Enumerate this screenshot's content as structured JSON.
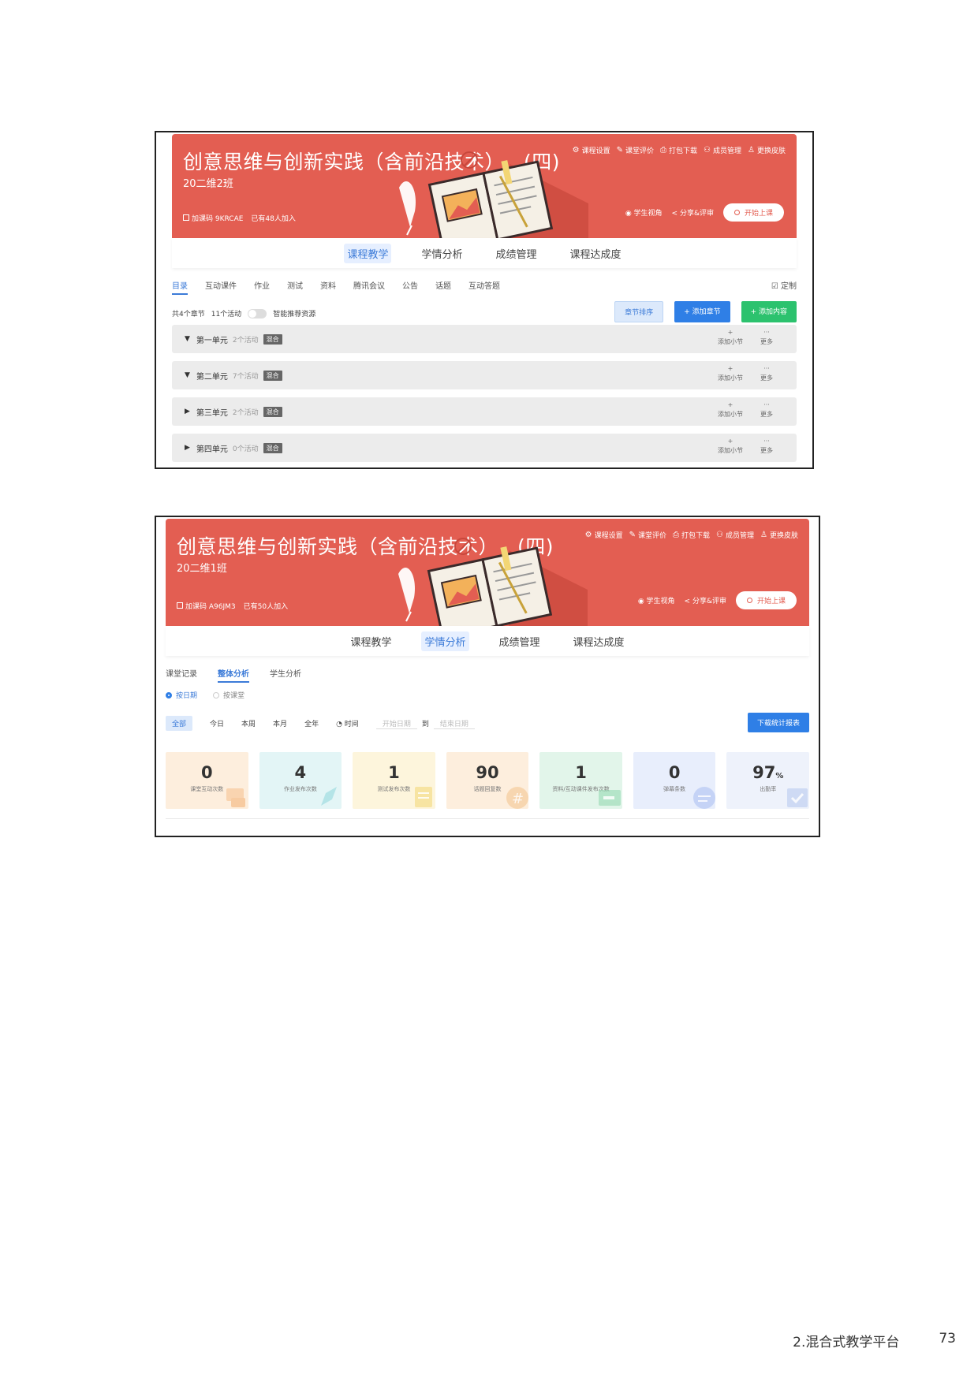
{
  "screenshot_top": {
    "course_title": "创意思维与创新实践（含前沿技术）",
    "course_suffix": "(四)",
    "class_name": "20二维2班",
    "join_code": "加课码 9KRCAE",
    "joined": "已有48人加入",
    "top_menu": [
      "课程设置",
      "课堂评价",
      "打包下载",
      "成员管理",
      "更换皮肤"
    ],
    "bottom_menu": [
      "学生视角",
      "分享&评审"
    ],
    "start_label": "开始上课",
    "main_tabs": [
      "课程教学",
      "学情分析",
      "成绩管理",
      "课程达成度"
    ],
    "sub_tabs": [
      "目录",
      "互动课件",
      "作业",
      "测试",
      "资料",
      "腾讯会议",
      "公告",
      "话题",
      "互动答题"
    ],
    "customize": "定制",
    "chapter_count": "共4个章节",
    "activity_count": "11个活动",
    "smart_recommend": "智能推荐资源",
    "buttons": {
      "order": "章节排序",
      "add_chapter": "+ 添加章节",
      "add_content": "+ 添加内容"
    },
    "units": [
      {
        "name": "第一单元",
        "count": "2个活动",
        "badge": "混合",
        "arrow": "▼"
      },
      {
        "name": "第二单元",
        "count": "7个活动",
        "badge": "混合",
        "arrow": "▼"
      },
      {
        "name": "第三单元",
        "count": "2个活动",
        "badge": "混合",
        "arrow": "▶"
      },
      {
        "name": "第四单元",
        "count": "0个活动",
        "badge": "混合",
        "arrow": "▶"
      }
    ],
    "unit_actions": [
      "添加小节",
      "更多"
    ]
  },
  "screenshot_bottom": {
    "course_title": "创意思维与创新实践（含前沿技术）",
    "course_suffix": "(四)",
    "class_name": "20二维1班",
    "join_code": "加课码 A96JM3",
    "joined": "已有50人加入",
    "top_menu": [
      "课程设置",
      "课堂评价",
      "打包下载",
      "成员管理",
      "更换皮肤"
    ],
    "bottom_menu": [
      "学生视角",
      "分享&评审"
    ],
    "start_label": "开始上课",
    "main_tabs": [
      "课程教学",
      "学情分析",
      "成绩管理",
      "课程达成度"
    ],
    "analysis_tabs": [
      "课堂记录",
      "整体分析",
      "学生分析"
    ],
    "radios": [
      "按日期",
      "按课堂"
    ],
    "filters": [
      "全部",
      "今日",
      "本周",
      "本月",
      "全年"
    ],
    "time_label": "时间",
    "start_date": "开始日期",
    "to": "到",
    "end_date": "结束日期",
    "download": "下载统计报表",
    "cards": [
      {
        "value": "0",
        "label": "课堂互动次数",
        "color": "#fdeedd",
        "accent": "#f6c08a"
      },
      {
        "value": "4",
        "label": "作业发布次数",
        "color": "#e3f5f6",
        "accent": "#8fd6db"
      },
      {
        "value": "1",
        "label": "测试发布次数",
        "color": "#fdf5dc",
        "accent": "#f3d674"
      },
      {
        "value": "90",
        "label": "话题回复数",
        "color": "#fdeedd",
        "accent": "#f3c48a"
      },
      {
        "value": "1",
        "label": "资料/互动课件发布次数",
        "color": "#e2f5ea",
        "accent": "#8fd7ad"
      },
      {
        "value": "0",
        "label": "弹幕条数",
        "color": "#e8eefc",
        "accent": "#a8bdf1"
      },
      {
        "value": "97",
        "suffix": "%",
        "label": "出勤率",
        "color": "#eef2fb",
        "accent": "#b5c6ee"
      }
    ]
  },
  "footer": {
    "section": "2.混合式教学平台",
    "page_number": "73"
  },
  "colors": {
    "banner": "#e35e52",
    "accent_blue": "#2f7fe6",
    "accent_green": "#2cc26e"
  }
}
